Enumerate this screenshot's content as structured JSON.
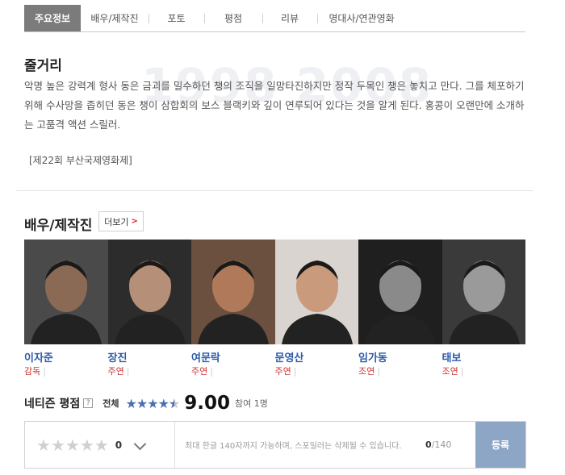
{
  "tabs": [
    {
      "label": "주요정보",
      "active": true
    },
    {
      "label": "배우/제작진"
    },
    {
      "label": "포토"
    },
    {
      "label": "평점"
    },
    {
      "label": "리뷰"
    },
    {
      "label": "명대사/연관영화"
    }
  ],
  "story": {
    "title": "줄거리",
    "watermark": "1998 2008",
    "text": "악명 높은 강력계 형사 동은 금괴를 밀수하던 챙의 조직을 일망타진하지만 정작 두목인 챙은 놓치고 만다. 그를 체포하기 위해 수사망을 좁히던 동은 챙이 삼합회의 보스 블랙키와 깊이 연루되어 있다는 것을 알게 된다. 홍콩이 오랜만에 소개하는 고품격 액션 스릴러.",
    "festival": "[제22회 부산국제영화제]"
  },
  "cast_section": {
    "title": "배우/제작진",
    "more_label": "더보기",
    "people": [
      {
        "name": "이자준",
        "role": "감독",
        "bg": "#4a4a4a",
        "skin": "#8a6a55"
      },
      {
        "name": "장진",
        "role": "주연",
        "bg": "#2c2c2c",
        "skin": "#b58f78"
      },
      {
        "name": "여문락",
        "role": "주연",
        "bg": "#6b5040",
        "skin": "#b07a5a"
      },
      {
        "name": "문영산",
        "role": "주연",
        "bg": "#d9d4cf",
        "skin": "#c99a7c"
      },
      {
        "name": "임가동",
        "role": "조연",
        "bg": "#1f1f1f",
        "skin": "#8a8a8a"
      },
      {
        "name": "태보",
        "role": "조연",
        "bg": "#3a3a3a",
        "skin": "#9a9a9a"
      }
    ]
  },
  "rating": {
    "title": "네티즌 평점",
    "help": "?",
    "total_label": "전체",
    "score": "9.00",
    "count": "참여 1명",
    "star_value": 4.5,
    "accent": "#4a6fb3"
  },
  "review_box": {
    "my_score": "0",
    "placeholder": "최대 한글 140자까지 가능하며, 스포일러는 삭제될 수 있습니다.",
    "counter_current": "0",
    "counter_max": "/140",
    "submit_label": "등록"
  }
}
